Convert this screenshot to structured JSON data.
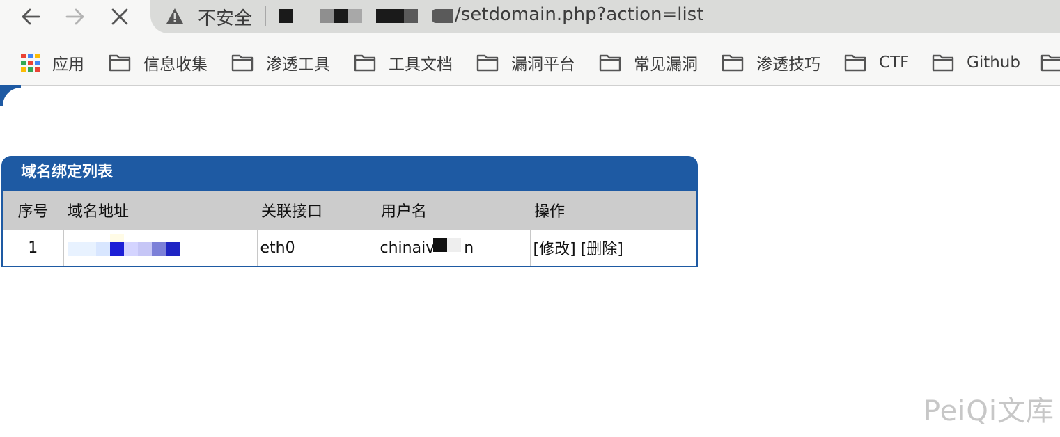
{
  "browser": {
    "address_bar": {
      "security_label": "不安全",
      "url_path": "/setdomain.php?action=list"
    },
    "bookmarks": [
      {
        "label": "应用",
        "icon": "apps-grid-icon"
      },
      {
        "label": "信息收集",
        "icon": "folder-icon"
      },
      {
        "label": "渗透工具",
        "icon": "folder-icon"
      },
      {
        "label": "工具文档",
        "icon": "folder-icon"
      },
      {
        "label": "漏洞平台",
        "icon": "folder-icon"
      },
      {
        "label": "常见漏洞",
        "icon": "folder-icon"
      },
      {
        "label": "渗透技巧",
        "icon": "folder-icon"
      },
      {
        "label": "CTF",
        "icon": "folder-icon"
      },
      {
        "label": "Github",
        "icon": "folder-icon"
      }
    ]
  },
  "panel": {
    "title": "域名绑定列表",
    "columns": [
      "序号",
      "域名地址",
      "关联接口",
      "用户名",
      "操作"
    ],
    "rows": [
      {
        "index": "1",
        "interface": "eth0",
        "username": "chinaiv",
        "username_tail": "n",
        "edit": "[修改]",
        "delete": "[删除]"
      }
    ]
  },
  "watermark": "PeiQi文库",
  "colors": {
    "header_blue": "#1e5aa3",
    "table_header_gray": "#cccccc",
    "omnibox": "#dadbd9"
  }
}
